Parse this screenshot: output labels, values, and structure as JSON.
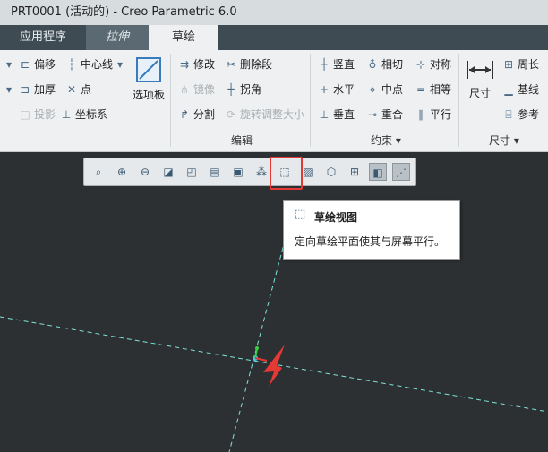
{
  "window": {
    "title": "PRT0001 (活动的) - Creo Parametric 6.0"
  },
  "tabs": [
    {
      "label": "应用程序"
    },
    {
      "label": "拉伸"
    },
    {
      "label": "草绘"
    }
  ],
  "ribbon": {
    "setup": {
      "offset": "偏移",
      "thicken": "加厚",
      "project": "投影",
      "centerline": "中心线",
      "point": "点",
      "coord_sys": "坐标系",
      "palette": "选项板"
    },
    "editing": {
      "modify": "修改",
      "mirror": "镜像",
      "divide": "分割",
      "delete_segment": "删除段",
      "corner": "拐角",
      "rotate_resize": "旋转调整大小",
      "group_label": "编辑"
    },
    "constrain": {
      "vertical": "竖直",
      "horizontal": "水平",
      "perpendicular": "垂直",
      "tangent": "相切",
      "midpoint": "中点",
      "coincident": "重合",
      "symmetric": "对称",
      "equal": "相等",
      "parallel": "平行",
      "group_label": "约束"
    },
    "dimension": {
      "dimension": "尺寸",
      "perimeter": "周长",
      "baseline": "基线",
      "reference": "参考",
      "group_label": "尺寸"
    }
  },
  "tooltip": {
    "title": "草绘视图",
    "description": "定向草绘平面使其与屏幕平行。"
  },
  "colors": {
    "canvas": "#2c3032",
    "grid_line": "#7fe3d8",
    "highlight": "#e53935",
    "arrow": "#e53935"
  }
}
